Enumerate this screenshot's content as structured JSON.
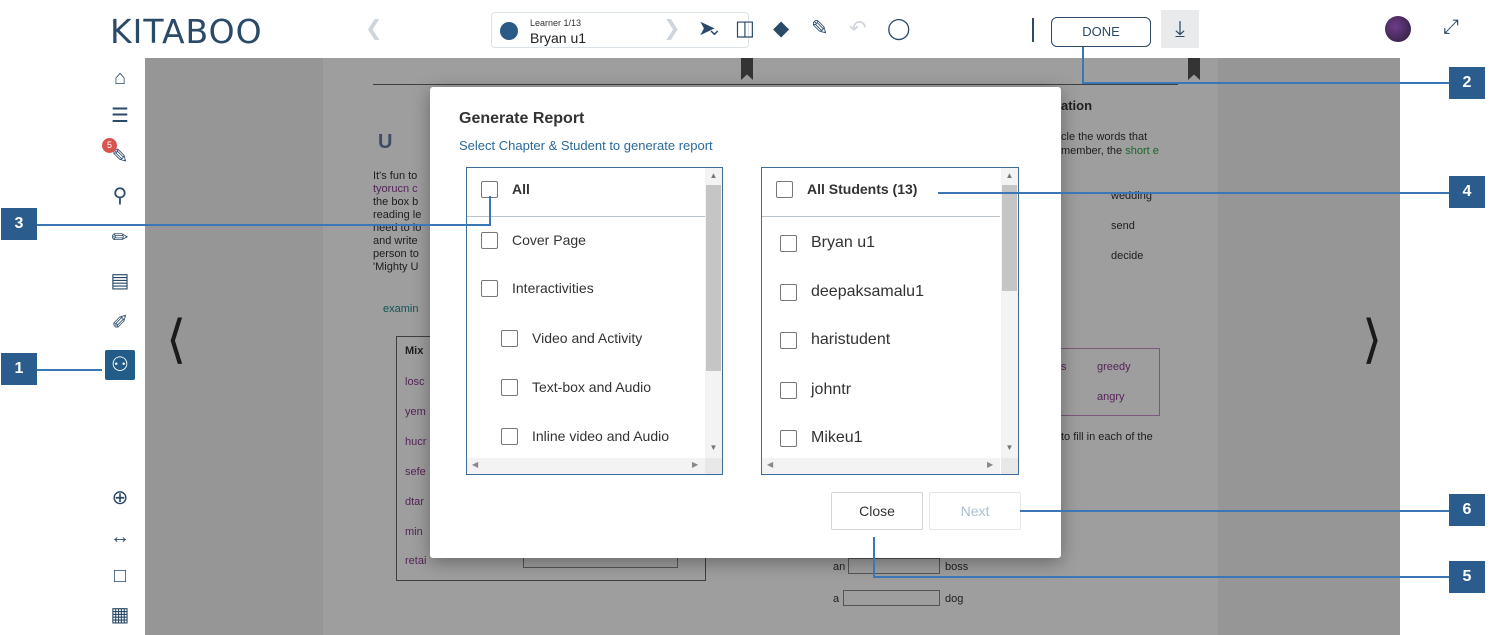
{
  "app": {
    "logo": "KITABOO"
  },
  "toolbar": {
    "learner_caption": "Learner 1/13",
    "learner_name": "Bryan  u1",
    "done_label": "DONE"
  },
  "sidebar": {
    "notification_count": "5"
  },
  "page": {
    "left_intro": [
      "It's fun to",
      "tyorucn c",
      "the box b",
      "reading le",
      "need to lo",
      "and write",
      "person to",
      "'Mighty U"
    ],
    "left_link": "examin",
    "table_header": "Mix",
    "table_rows": [
      "losc",
      "yem",
      "hucr",
      "sefe",
      "dtar",
      "min",
      "retai"
    ],
    "right_heading": "ation",
    "right_text_1": "cle the words that",
    "right_text_2": "member, the",
    "right_text_2_highlight": "short e",
    "right_words": [
      "wedding",
      "send",
      "decide"
    ],
    "right_box_words_left": [
      "s"
    ],
    "right_box_words": [
      "greedy",
      "angry"
    ],
    "right_fill_text": "to fill in each of the",
    "right_blank_1_prefix": "an",
    "right_blank_1_suffix": "boss",
    "right_blank_2_prefix": "a",
    "right_blank_2_suffix": "dog"
  },
  "modal": {
    "title": "Generate Report",
    "subtitle": "Select Chapter & Student to generate report",
    "chapters": {
      "all_label": "All",
      "items": [
        {
          "label": "Cover Page"
        },
        {
          "label": "Interactivities"
        },
        {
          "label": "Video and Activity"
        },
        {
          "label": "Text-box and Audio"
        },
        {
          "label": "Inline video and Audio"
        }
      ]
    },
    "students": {
      "all_label": "All Students (13)",
      "items": [
        {
          "label": "Bryan u1"
        },
        {
          "label": "deepaksamalu1"
        },
        {
          "label": "haristudent"
        },
        {
          "label": "johntr"
        },
        {
          "label": "Mikeu1"
        }
      ]
    },
    "close_label": "Close",
    "next_label": "Next"
  },
  "callouts": [
    "1",
    "2",
    "3",
    "4",
    "5",
    "6"
  ],
  "colors": {
    "brand": "#2a4a68",
    "callout": "#2a5d8d",
    "callout_line": "#3a77b7",
    "panel_border": "#3d6c99",
    "active_tool": "#225d8a"
  }
}
